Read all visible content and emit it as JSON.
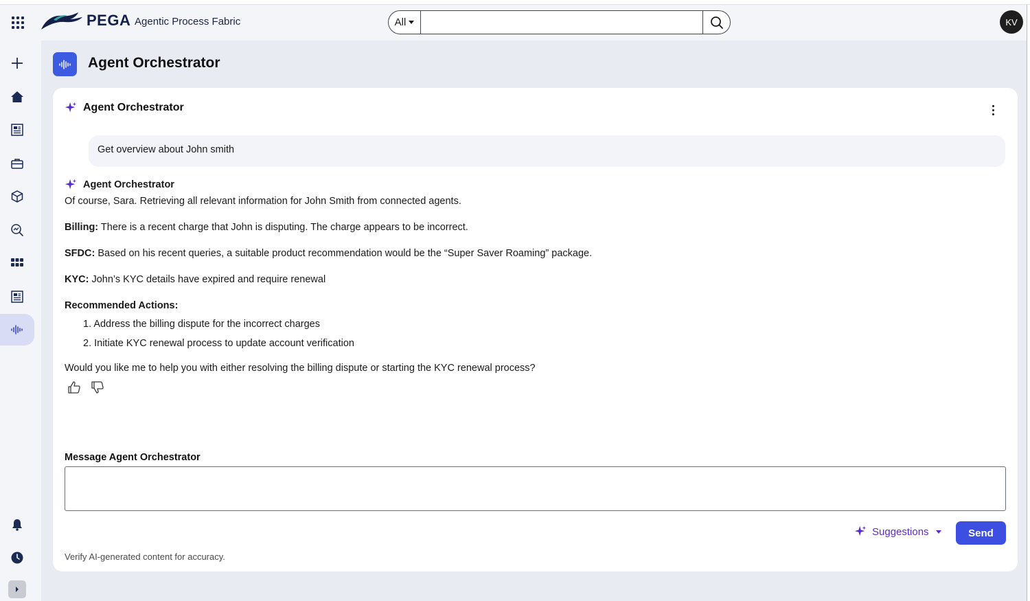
{
  "header": {
    "logo_text": "PEGA",
    "app_name": "Agentic Process Fabric",
    "search": {
      "scope": "All",
      "placeholder": "",
      "value": ""
    },
    "user_initials": "KV",
    "apps_icon": "grid-icon",
    "search_icon": "search-icon"
  },
  "leftnav": {
    "items": [
      {
        "name": "create",
        "icon": "plus-icon"
      },
      {
        "name": "home",
        "icon": "home-icon"
      },
      {
        "name": "news",
        "icon": "newspaper-icon"
      },
      {
        "name": "work",
        "icon": "briefcase-icon"
      },
      {
        "name": "cube",
        "icon": "cube-icon"
      },
      {
        "name": "explore",
        "icon": "search-chart-icon"
      },
      {
        "name": "apps",
        "icon": "apps-grid-icon"
      },
      {
        "name": "reports",
        "icon": "newspaper-icon"
      },
      {
        "name": "agent-orchestrator",
        "icon": "waveform-icon",
        "active": true
      }
    ],
    "bottom": [
      {
        "name": "notifications",
        "icon": "bell-icon"
      },
      {
        "name": "history",
        "icon": "clock-icon"
      },
      {
        "name": "expand",
        "icon": "expand-icon"
      }
    ]
  },
  "page": {
    "title": "Agent Orchestrator"
  },
  "chat": {
    "title": "Agent Orchestrator",
    "user_message": "Get overview about John smith",
    "reply": {
      "sender": "Agent Orchestrator",
      "intro": "Of course, Sara. Retrieving all relevant information for John Smith from connected agents.",
      "billing_label": "Billing:",
      "billing_text": " There is a recent charge that John is disputing. The charge appears to be incorrect.",
      "sfdc_label": "SFDC:",
      "sfdc_text": " Based on his recent queries, a suitable product recommendation would be the “Super Saver Roaming” package.",
      "kyc_label": "KYC:",
      "kyc_text": " John’s KYC details have expired and require renewal",
      "actions_title": "Recommended Actions:",
      "actions": [
        "1. Address the billing dispute for the incorrect charges",
        "2. Initiate KYC renewal process to update account verification"
      ],
      "closing": "Would you like me to help you with either resolving the billing dispute or starting the KYC renewal process?"
    },
    "composer": {
      "label": "Message Agent Orchestrator",
      "value": "",
      "suggestions_label": "Suggestions",
      "send_label": "Send",
      "disclaimer": "Verify AI-generated content for accuracy."
    }
  },
  "colors": {
    "accent": "#3c4fe0",
    "sparkle": "#5b2bd1",
    "page_bg": "#e9ebf3",
    "nav_active": "#d8dcf4"
  }
}
